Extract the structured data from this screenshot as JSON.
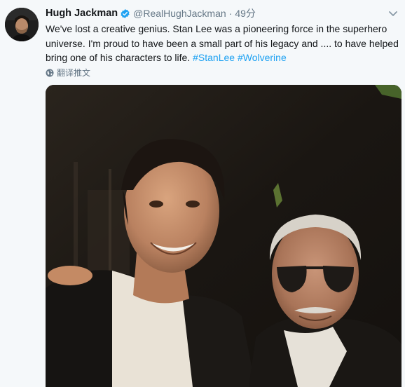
{
  "tweet": {
    "author_name": "Hugh Jackman",
    "handle": "@RealHughJackman",
    "separator": "·",
    "time": "49分",
    "text_lines": [
      "We've lost a creative genius. Stan Lee was a pioneering force in the superhero",
      "universe. I'm proud to have been a small part of his legacy and .... to have helped",
      "bring one of his characters to life. "
    ],
    "hashtags": [
      "#StanLee",
      "#Wolverine"
    ],
    "translate_label": "翻译推文"
  },
  "icons": {
    "verified": "verified-badge-icon",
    "caret": "chevron-down-icon",
    "translate": "globe-icon"
  },
  "colors": {
    "background": "#f5f8fa",
    "link": "#1da1f2",
    "verified": "#1da1f2",
    "muted": "#657786",
    "text": "#14171a"
  }
}
